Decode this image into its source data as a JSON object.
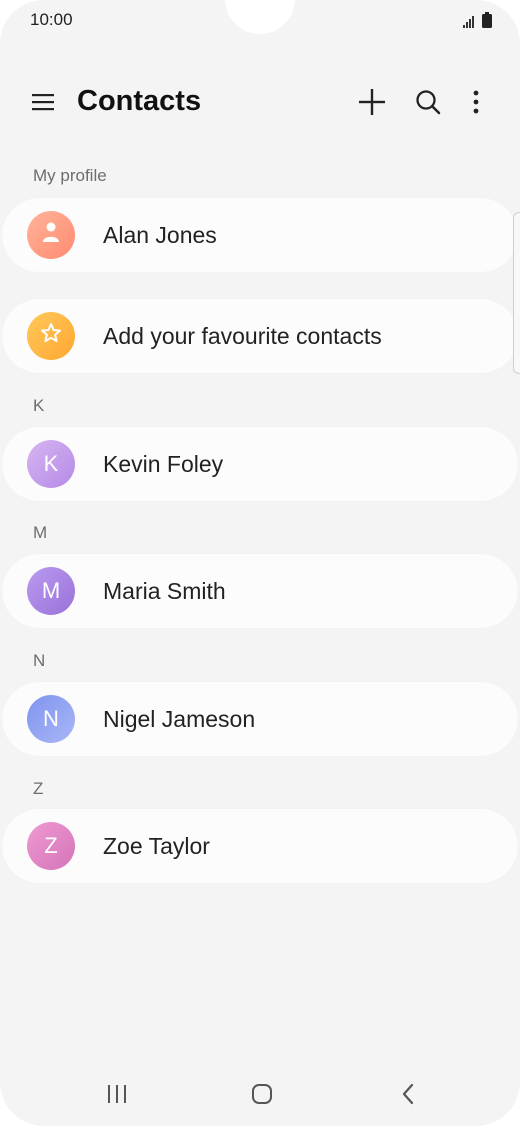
{
  "status_bar": {
    "time": "10:00",
    "icons": [
      "signal-icon",
      "battery-icon"
    ]
  },
  "app_bar": {
    "menu_icon": "hamburger-icon",
    "title": "Contacts",
    "actions": [
      "add-icon",
      "search-icon",
      "more-options-icon"
    ]
  },
  "profile_section": {
    "label": "My profile",
    "contact": {
      "name": "Alan Jones",
      "avatar_icon": "person-icon",
      "avatar_color": "#ff9a7e"
    }
  },
  "favourites": {
    "label": "Add your favourite contacts",
    "icon": "star-icon",
    "icon_color": "#ffb43d"
  },
  "groups": [
    {
      "letter": "K",
      "contacts": [
        {
          "name": "Kevin Foley",
          "initial": "K",
          "avatar_color": "#c9a3ea"
        }
      ]
    },
    {
      "letter": "M",
      "contacts": [
        {
          "name": "Maria Smith",
          "initial": "M",
          "avatar_color": "#a989e4"
        }
      ]
    },
    {
      "letter": "N",
      "contacts": [
        {
          "name": "Nigel Jameson",
          "initial": "N",
          "avatar_color": "#8fa6f0"
        }
      ]
    },
    {
      "letter": "Z",
      "contacts": [
        {
          "name": "Zoe Taylor",
          "initial": "Z",
          "avatar_color": "#e58ac8"
        }
      ]
    }
  ],
  "nav_bar": {
    "buttons": [
      "recent-apps-icon",
      "home-icon",
      "back-icon"
    ]
  }
}
